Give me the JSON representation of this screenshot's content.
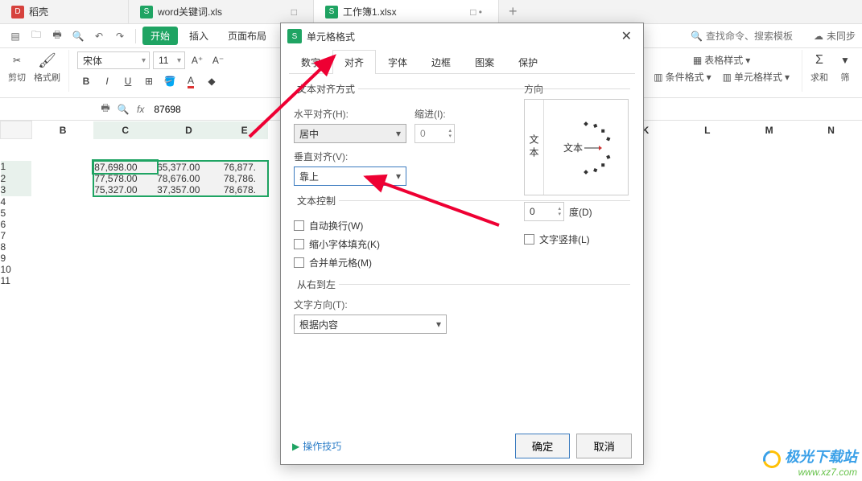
{
  "tabs": [
    {
      "icon": "red",
      "iconText": "D",
      "title": "稻壳",
      "status": ""
    },
    {
      "icon": "green",
      "iconText": "S",
      "title": "word关键词.xls",
      "status": "□"
    },
    {
      "icon": "green",
      "iconText": "S",
      "title": "工作簿1.xlsx",
      "status": "□ •",
      "active": true
    }
  ],
  "tab_add": "+",
  "menu": {
    "items": [
      "开始",
      "插入",
      "页面布局"
    ],
    "search_placeholder": "查找命令、搜索模板",
    "sync": "未同步"
  },
  "ribbon": {
    "cut": "剪切",
    "brush": "格式刷",
    "font_name": "宋体",
    "font_size": "11",
    "right_items": [
      "表格样式",
      "条件格式",
      "单元格样式",
      "求和",
      "筛"
    ]
  },
  "formula": {
    "value": "87698"
  },
  "columns": [
    "B",
    "C",
    "D",
    "E",
    "K",
    "L",
    "M",
    "N"
  ],
  "rows": [
    "1",
    "2",
    "3",
    "4",
    "5",
    "6",
    "7",
    "8",
    "9",
    "10",
    "11"
  ],
  "chart_data": {
    "type": "table",
    "columns": [
      "C",
      "D",
      "E"
    ],
    "rows": [
      [
        "87,698.00",
        "65,377.00",
        "76,877."
      ],
      [
        "77,578.00",
        "78,676.00",
        "78,786."
      ],
      [
        "75,327.00",
        "37,357.00",
        "78,678."
      ]
    ]
  },
  "dialog": {
    "title": "单元格格式",
    "tabs": [
      "数字",
      "对齐",
      "字体",
      "边框",
      "图案",
      "保护"
    ],
    "active_tab": 1,
    "text_align_legend": "文本对齐方式",
    "h_align_label": "水平对齐(H):",
    "h_align_value": "居中",
    "indent_label": "缩进(I):",
    "indent_value": "0",
    "v_align_label": "垂直对齐(V):",
    "v_align_value": "靠上",
    "text_ctrl_legend": "文本控制",
    "wrap": "自动换行(W)",
    "shrink": "缩小字体填充(K)",
    "merge": "合并单元格(M)",
    "rtl_legend": "从右到左",
    "textdir_label": "文字方向(T):",
    "textdir_value": "根据内容",
    "direction_legend": "方向",
    "direction_text_v": "文本",
    "direction_text_h": "文本",
    "angle_value": "0",
    "angle_unit": "度(D)",
    "vertical_text_chk": "文字竖排(L)",
    "tips": "操作技巧",
    "ok": "确定",
    "cancel": "取消"
  },
  "watermark": {
    "cn": "极光下载站",
    "url": "www.xz7.com"
  }
}
